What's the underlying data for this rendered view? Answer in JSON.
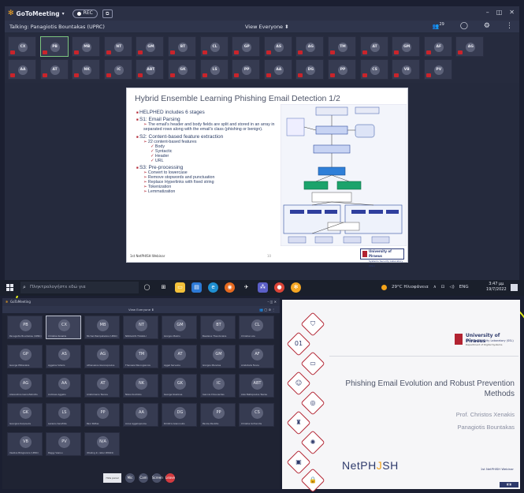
{
  "top_window": {
    "app_name": "GoToMeeting",
    "rec_label": "REC",
    "talking": "Talking: Panagiotis Bountakas (UPRC)",
    "view_label": "View Everyone",
    "attendee_count": "29",
    "row1": [
      "CX",
      "PB",
      "MB",
      "NT",
      "GM",
      "BT",
      "CL",
      "GP",
      "AS",
      "AG",
      "TM",
      "AT",
      "GM",
      "AF",
      "AG"
    ],
    "row2": [
      "AA",
      "AT",
      "NK",
      "IC",
      "ABT",
      "GK",
      "LS",
      "PP",
      "AA",
      "DG",
      "PP",
      "CS",
      "VB",
      "PV"
    ]
  },
  "slide_top": {
    "title": "Hybrid Ensemble Learning Phishing Email Detection 1/2",
    "bullets": [
      {
        "level": 1,
        "text": "HELPHED includes 6 stages"
      },
      {
        "level": 1,
        "text": "S1: Email Parsing"
      },
      {
        "level": 2,
        "text": "The email’s header and body fields are split and stored in an array in separated rows along with the email’s class (phishing or benign)."
      },
      {
        "level": 1,
        "text": "S2: Content-based feature extraction"
      },
      {
        "level": 2,
        "text": "22 content-based features"
      },
      {
        "level": 3,
        "text": "Body"
      },
      {
        "level": 3,
        "text": "Syntactic"
      },
      {
        "level": 3,
        "text": "Header"
      },
      {
        "level": 3,
        "text": "URL"
      },
      {
        "level": 1,
        "text": "S3: Pre-processing"
      },
      {
        "level": 2,
        "text": "Convert to lowercase"
      },
      {
        "level": 2,
        "text": "Remove stopwords and punctuation"
      },
      {
        "level": 2,
        "text": "Replace Hyperlinks with fixed string"
      },
      {
        "level": 2,
        "text": "Tokenization"
      },
      {
        "level": 2,
        "text": "Lemmatization"
      }
    ],
    "footer": "1st NetPHISH Webinar",
    "page": "10",
    "university": "University of Piraeus",
    "university_sub": "Systems Security Laboratory (SSL)"
  },
  "taskbar": {
    "search_placeholder": "Πληκτρολογήστε εδώ για",
    "weather": "29°C Ηλιοφάνεια",
    "lang": "ENG",
    "time": "3:47 μμ",
    "date": "19/7/2022"
  },
  "bottom_window": {
    "view_label": "View Everyone",
    "tiles": [
      {
        "initials": "PB",
        "name": "Panagiotis Bountakas (UPRC)"
      },
      {
        "initials": "CX",
        "name": "Christos Xenakis"
      },
      {
        "initials": "MB",
        "name": "Michail Bampatsikos (UPRC)"
      },
      {
        "initials": "NT",
        "name": "NIKOLAOS TSAKALI"
      },
      {
        "initials": "GM",
        "name": "Giorgos Makris"
      },
      {
        "initials": "BT",
        "name": "Basileios Theodorakis"
      },
      {
        "initials": "CL",
        "name": "Christos Lios"
      },
      {
        "initials": "GP",
        "name": "George Pitikarakis"
      },
      {
        "initials": "AS",
        "name": "Aggelos Sideris"
      },
      {
        "initials": "AG",
        "name": "Athanasios Giannopoulos"
      },
      {
        "initials": "TM",
        "name": "Thanasis Mavrogiannis"
      },
      {
        "initials": "AT",
        "name": "Aggel Sarvelos"
      },
      {
        "initials": "GM",
        "name": "Giorgos Manolas"
      },
      {
        "initials": "AF",
        "name": "Aristotelis Fanos"
      },
      {
        "initials": "AG",
        "name": "Alexandros Garoufalinidis"
      },
      {
        "initials": "AA",
        "name": "Andreas Aggelis"
      },
      {
        "initials": "AT",
        "name": "Aristomenis Tsanos"
      },
      {
        "initials": "NK",
        "name": "Nikos Koutrolis"
      },
      {
        "initials": "GK",
        "name": "George Koskinas"
      },
      {
        "initials": "IC",
        "name": "Ioannis Chouvardas"
      },
      {
        "initials": "ABT",
        "name": "Alex Baltopoulos Tsaras"
      },
      {
        "initials": "GK",
        "name": "Georgios Karpouzis"
      },
      {
        "initials": "LS",
        "name": "Lazaros Sarafidis"
      },
      {
        "initials": "PP",
        "name": "Paul Pettas"
      },
      {
        "initials": "AA",
        "name": "Anna Aggelopoulou"
      },
      {
        "initials": "DG",
        "name": "Dimitris Giannoulis"
      },
      {
        "initials": "PP",
        "name": "Pavlos Paulidis"
      },
      {
        "initials": "CS",
        "name": "Christos Sofronidis"
      },
      {
        "initials": "VB",
        "name": "Vasilios Bilogiannis (UPRC)"
      },
      {
        "initials": "PV",
        "name": "Peggy Vasiou"
      },
      {
        "initials": "N/A",
        "name": "(Dialing In caller #8401)"
      }
    ],
    "controls": {
      "mic": "Mic",
      "cam": "Cam",
      "screen": "Screen",
      "more": "More",
      "leave": "Leave",
      "panel": "Hide panel"
    }
  },
  "slide_bottom": {
    "university": "University of Piraeus",
    "lab": "Systems Security Laboratory (SSL)",
    "dept": "Department of Digital Systems",
    "title": "Phishing Email Evolution and Robust Prevention Methods",
    "author1": "Prof. Christos Xenakis",
    "author2": "Panagiotis Bountakas",
    "brand_left": "NetPH",
    "brand_hook": "J",
    "brand_right": "SH",
    "webinar": "1st NetPHISH Webinar",
    "hex_icons": [
      "user-shield-icon",
      "binary-icon",
      "laptop-icon",
      "person-icon",
      "fingerprint-icon",
      "tower-icon",
      "virus-icon",
      "monitor-icon",
      "lock-icon",
      "antenna-icon",
      "phone-icon"
    ]
  }
}
